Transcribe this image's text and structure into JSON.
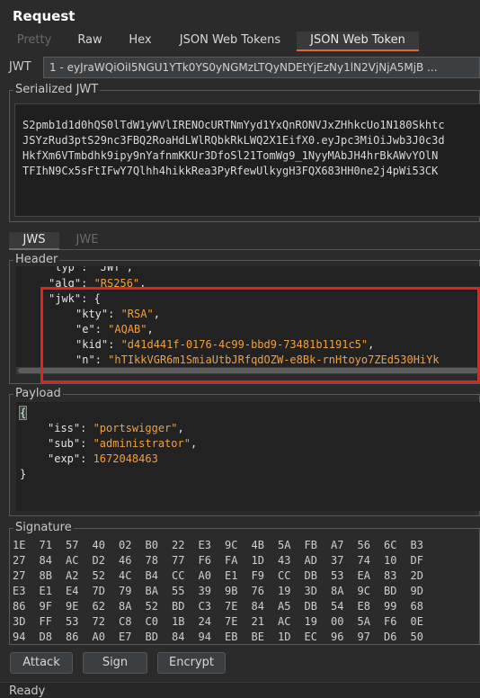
{
  "panel": {
    "title": "Request"
  },
  "tabs": [
    {
      "label": "Pretty",
      "state": "disabled"
    },
    {
      "label": "Raw",
      "state": "normal"
    },
    {
      "label": "Hex",
      "state": "normal"
    },
    {
      "label": "JSON Web Tokens",
      "state": "normal"
    },
    {
      "label": "JSON Web Token",
      "state": "active"
    }
  ],
  "jwt_selector": {
    "label": "JWT",
    "value": "1 - eyJraWQiOiI5NGU1YTk0YS0yNGMzLTQyNDEtYjEzNy1lN2VjNjA5MjB ..."
  },
  "serialized": {
    "label": "Serialized JWT",
    "lines": [
      "S2pmb1d1d0hQS0lTdW1yWVlIRENOcURTNmYyd1YxQnRONVJxZHhkcUo1N180Skhtc",
      "JSYzRud3ptS29nc3FBQ2RoaHdLWlRQbkRkLWQ2X1EifX0.eyJpc3MiOiJwb3J0c3d",
      "HkfXm6VTmbdhk9ipy9nYafnmKKUr3DfoSl21TomWg9_1NyyMAbJH4hrBkAWvYOlN",
      "TFIhN9Cx5sFtIFwY7Qlhh4hikkRea3PyRfewUlkygH3FQX683HH0ne2j4pWi53CK"
    ]
  },
  "subtabs": [
    {
      "label": "JWS",
      "state": "active"
    },
    {
      "label": "JWE",
      "state": "disabled"
    }
  ],
  "header": {
    "label": "Header",
    "partial_top": "\"typ\": \"JWT\",",
    "alg_key": "\"alg\"",
    "alg_value": "\"RS256\"",
    "jwk_key": "\"jwk\"",
    "kty_key": "\"kty\"",
    "kty_value": "\"RSA\"",
    "e_key": "\"e\"",
    "e_value": "\"AQAB\"",
    "kid_key": "\"kid\"",
    "kid_value": "\"d41d441f-0176-4c99-bbd9-73481b1191c5\"",
    "n_key": "\"n\"",
    "n_value": "\"hTIkkVGR6m1SmiaUtbJRfqdOZW-e8Bk-rnHtoyo7ZEd530HiYk"
  },
  "payload": {
    "label": "Payload",
    "open_brace": "{",
    "close_brace": "}",
    "iss_key": "\"iss\"",
    "iss_value": "\"portswigger\"",
    "sub_key": "\"sub\"",
    "sub_value": "\"administrator\"",
    "exp_key": "\"exp\"",
    "exp_value": "1672048463"
  },
  "signature": {
    "label": "Signature",
    "rows": [
      [
        "1E",
        "71",
        "57",
        "40",
        "02",
        "B0",
        "22",
        "E3",
        "9C",
        "4B",
        "5A",
        "FB",
        "A7",
        "56",
        "6C",
        "B3"
      ],
      [
        "27",
        "84",
        "AC",
        "D2",
        "46",
        "78",
        "77",
        "F6",
        "FA",
        "1D",
        "43",
        "AD",
        "37",
        "74",
        "10",
        "DF"
      ],
      [
        "27",
        "8B",
        "A2",
        "52",
        "4C",
        "B4",
        "CC",
        "A0",
        "E1",
        "F9",
        "CC",
        "DB",
        "53",
        "EA",
        "83",
        "2D"
      ],
      [
        "E3",
        "E1",
        "E4",
        "7D",
        "79",
        "BA",
        "55",
        "39",
        "9B",
        "76",
        "19",
        "3D",
        "8A",
        "9C",
        "BD",
        "9D"
      ],
      [
        "86",
        "9F",
        "9E",
        "62",
        "8A",
        "52",
        "BD",
        "C3",
        "7E",
        "84",
        "A5",
        "DB",
        "54",
        "E8",
        "99",
        "68"
      ],
      [
        "3D",
        "FF",
        "53",
        "72",
        "C8",
        "C0",
        "1B",
        "24",
        "7E",
        "21",
        "AC",
        "19",
        "00",
        "5A",
        "F6",
        "0E"
      ],
      [
        "94",
        "D8",
        "86",
        "A0",
        "E7",
        "BD",
        "84",
        "94",
        "EB",
        "BE",
        "1D",
        "EC",
        "96",
        "97",
        "D6",
        "50"
      ]
    ]
  },
  "buttons": {
    "attack": "Attack",
    "sign": "Sign",
    "encrypt": "Encrypt"
  },
  "status": {
    "text": "Ready"
  },
  "colors": {
    "accent": "#e0663a",
    "highlight_box": "#e2231a",
    "string": "#f0a040",
    "background": "#2b2b2b"
  }
}
